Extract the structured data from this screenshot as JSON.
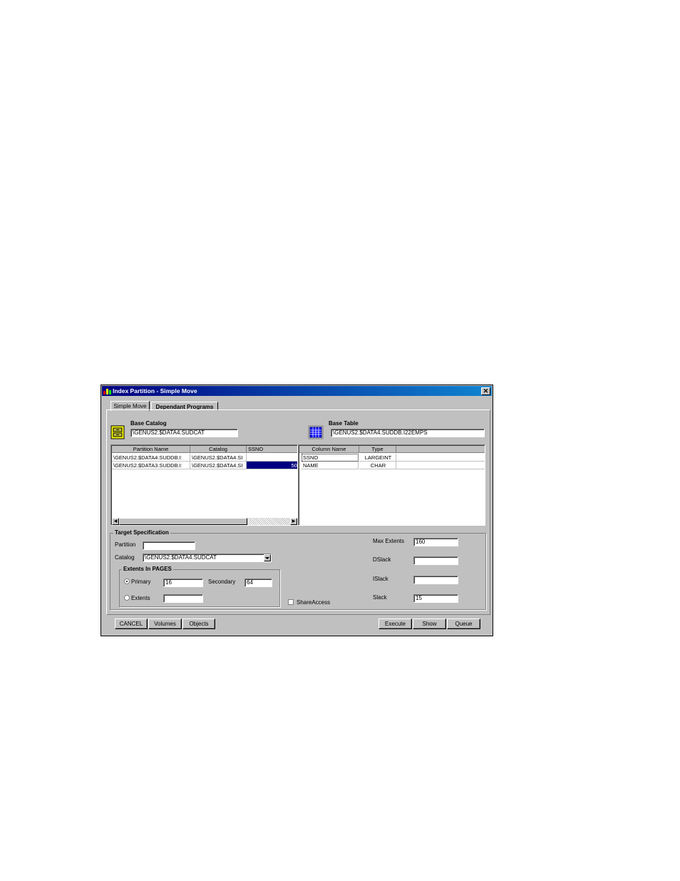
{
  "window": {
    "title": "Index Partition - Simple Move",
    "close_label": "✕"
  },
  "tabs": [
    {
      "label": "Simple Move",
      "active": true
    },
    {
      "label": "Dependant Programs",
      "active": false
    }
  ],
  "base_catalog": {
    "label": "Base Catalog",
    "value": "\\GENUS2.$DATA4.SUDCAT",
    "icon": "file-cabinet-icon"
  },
  "base_table": {
    "label": "Base Table",
    "value": "\\GENUS2.$DATA4.SUDDB.I22EMPS",
    "icon": "table-grid-icon"
  },
  "partition_grid": {
    "columns": [
      "Partition Name",
      "Catalog",
      "SSNO"
    ],
    "rows": [
      [
        "\\GENUS2.$DATA4.SUDDB.I:",
        "\\GENUS2.$DATA4.SI",
        ""
      ],
      [
        "\\GENUS2.$DATA3.SUDDB.I:",
        "\\GENUS2.$DATA4.SI",
        "50"
      ]
    ]
  },
  "column_grid": {
    "columns": [
      "Column Name",
      "Type"
    ],
    "rows": [
      [
        "SSNO",
        "LARGEINT"
      ],
      [
        "NAME",
        "CHAR"
      ]
    ]
  },
  "target": {
    "title": "Target Specification",
    "partition_label": "Partition",
    "partition_value": "",
    "catalog_label": "Catalog",
    "catalog_value": "\\GENUS2.$DATA4.SUDCAT",
    "extents_group": "Extents In PAGES",
    "primary_label": "Primary",
    "primary_value": "16",
    "secondary_label": "Secondary",
    "secondary_value": "64",
    "extents_label": "Extents",
    "extents_value": "",
    "max_extents_label": "Max Extents",
    "max_extents_value": "160",
    "dslack_label": "DSlack",
    "dslack_value": "",
    "islack_label": "ISlack",
    "islack_value": "",
    "slack_label": "Slack",
    "slack_value": "15",
    "shareaccess_label": "ShareAccess"
  },
  "buttons": {
    "cancel": "CANCEL",
    "volumes": "Volumes",
    "objects": "Objects",
    "execute": "Execute",
    "show": "Show",
    "queue": "Queue"
  }
}
